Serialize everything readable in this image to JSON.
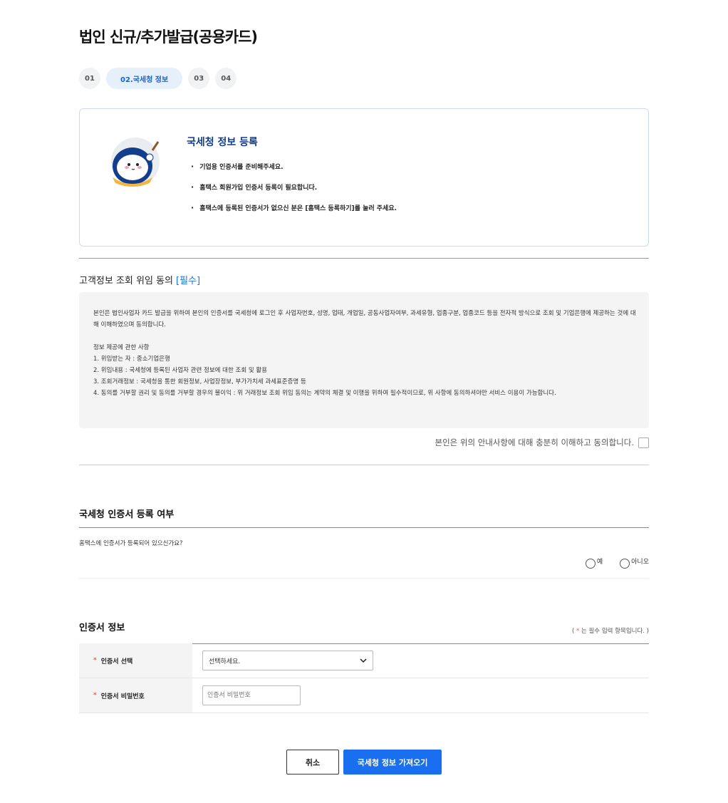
{
  "page": {
    "title": "법인 신규/추가발급(공용카드)"
  },
  "steps": [
    {
      "label": "01"
    },
    {
      "label": "02.국세청 정보"
    },
    {
      "label": "03"
    },
    {
      "label": "04"
    }
  ],
  "intro": {
    "title": "국세청 정보 등록",
    "items": [
      "기업용 인증서를 준비해주세요.",
      "홈택스 회원가입 인증서 등록이 필요합니다.",
      "홈택스에 등록된 인증서가 없으신 분은 [홈택스 등록하기]를 눌러 주세요."
    ]
  },
  "consent": {
    "title": "고객정보 조회 위임 동의",
    "required_label": "[필수]",
    "paragraph": "본인은 법인사업자 카드 발급을 위하여 본인의 인증서를 국세청에 로그인 후 사업자번호, 성명, 업태, 개업일, 공동사업자여부, 과세유형, 업종구분, 업종코드 등을 전자적 방식으로 조회 및 기업은행에 제공하는 것에 대해 이해하였으며 동의합니다.",
    "list_heading": "정보 제공에 관한 사항",
    "items": [
      "1. 위임받는 자 : 중소기업은행",
      "2. 위임내용 : 국세청에 등록된 사업자 관련 정보에 대한 조회 및 활용",
      "3. 조회거래정보 : 국세청을 통한 회원정보, 사업장정보, 부가가치세 과세표준증명 등",
      "4. 동의를 거부할 권리 및 동의를 거부할 경우의 불이익 : 위 거래정보 조회 위임 동의는 계약의 체결 및 이행을 위하여 필수적이므로, 위 사항에 동의하셔야만 서비스 이용이 가능합니다."
    ],
    "agree_label": "본인은 위의 안내사항에 대해 충분히 이해하고 동의합니다."
  },
  "hometax": {
    "title": "국세청 인증서 등록 여부",
    "question": "홈택스에 인증서가 등록되어 있으신가요?",
    "options": [
      "예",
      "아니오"
    ]
  },
  "cert": {
    "title": "인증서 정보",
    "note_prefix": "(",
    "note_star": "*",
    "note_suffix": "는 필수 입력 항목입니다. )",
    "select_label": "인증서 선택",
    "select_value": "선택하세요.",
    "password_label": "인증서 비밀번호",
    "password_placeholder": "인증서 비밀번호"
  },
  "buttons": {
    "cancel": "취소",
    "submit": "국세청 정보 가져오기"
  },
  "colors": {
    "accent": "#1a6ff0",
    "required_star": "#e8613c",
    "title_blue": "#0f3d8f"
  },
  "icons": {
    "mascot": "mascot-character-icon",
    "dropdown": "chevron-down-icon"
  }
}
